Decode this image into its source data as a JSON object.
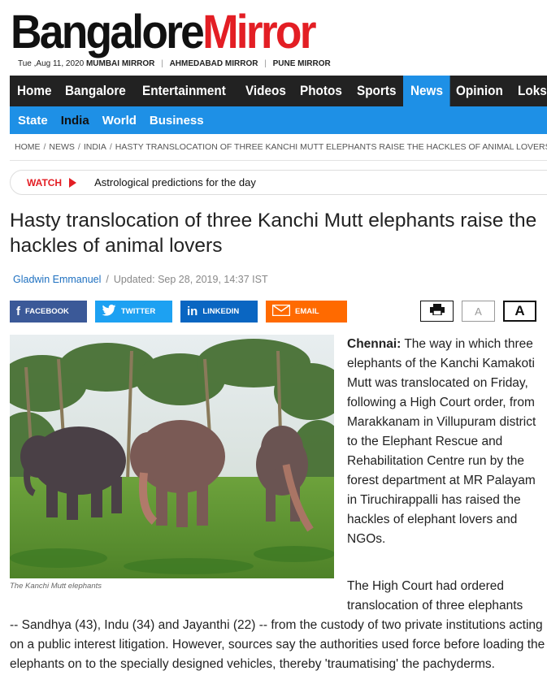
{
  "site": {
    "logo_part1": "Bangalore",
    "logo_part2": "Mirror"
  },
  "dateline": {
    "date": "Tue ,Aug 11, 2020",
    "editions": [
      "MUMBAI MIRROR",
      "AHMEDABAD MIRROR",
      "PUNE MIRROR"
    ]
  },
  "nav": {
    "items": [
      "Home",
      "Bangalore",
      "Entertainment",
      "Videos",
      "Photos",
      "Sports",
      "News",
      "Opinion",
      "Loksatta"
    ],
    "active": "News"
  },
  "subnav": {
    "items": [
      "State",
      "India",
      "World",
      "Business"
    ],
    "active": "India"
  },
  "breadcrumb": [
    "HOME",
    "NEWS",
    "INDIA",
    "HASTY TRANSLOCATION OF THREE KANCHI MUTT ELEPHANTS RAISE THE HACKLES OF ANIMAL LOVERS"
  ],
  "watch": {
    "label": "WATCH",
    "text": "Astrological predictions for the day"
  },
  "article": {
    "headline": "Hasty translocation of three Kanchi Mutt elephants raise the hackles of animal lovers",
    "author": "Gladwin Emmanuel",
    "updated": "Updated: Sep 28, 2019, 14:37 IST",
    "caption": "The Kanchi Mutt elephants",
    "p1_lead": "Chennai:",
    "p1": " The way in which three elephants of the Kanchi Kamakoti Mutt was translocated on Friday, following a High Court order, from Marakkanam in Villupuram district to the Elephant Rescue and Rehabilitation Centre run by the forest department at MR Palayam in Tiruchirappalli has raised the hackles of elephant lovers and NGOs.",
    "p2_part1": "The High Court had ordered translocation of three elephants",
    "p2_part2": "-- Sandhya (43), Indu (34) and Jayanthi (22) -- from the custody of two private institutions acting on a public interest litigation. However, sources say the authorities used force before loading the elephants on to the specially designed vehicles, thereby 'traumatising' the pachyderms."
  },
  "share": {
    "facebook": "FACEBOOK",
    "twitter": "TWITTER",
    "linkedin": "LINKEDIN",
    "email": "EMAIL"
  },
  "tools": {
    "font_small": "A",
    "font_large": "A"
  },
  "colors": {
    "brand_red": "#e31e24",
    "nav_dark": "#222222",
    "nav_blue": "#1e90e6"
  }
}
